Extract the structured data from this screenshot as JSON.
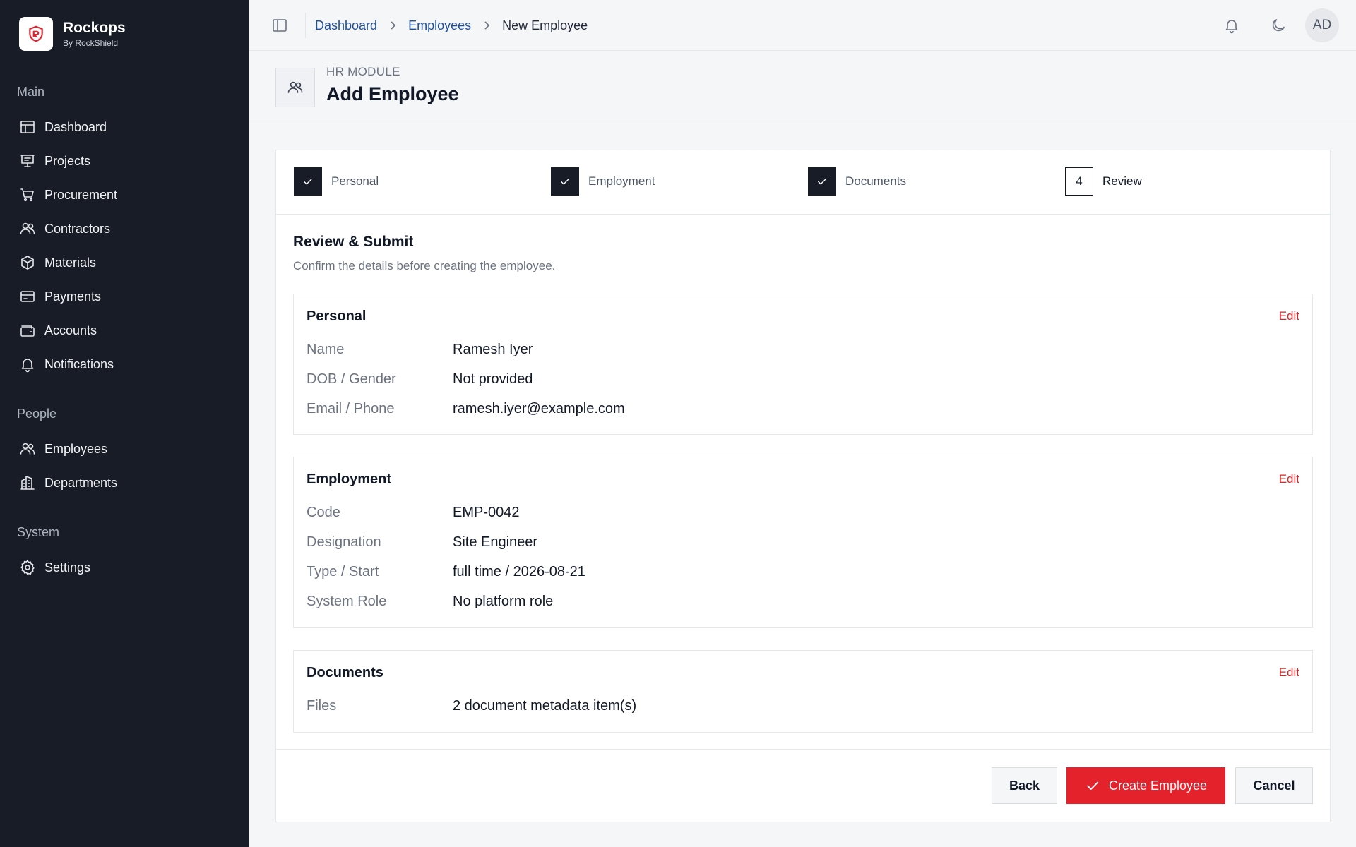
{
  "brand": {
    "name": "Rockops",
    "sub": "By RockShield",
    "accent": "#e3222c"
  },
  "sidebar": {
    "sections": [
      {
        "label": "Main",
        "items": [
          {
            "label": "Dashboard",
            "icon": "layout-icon"
          },
          {
            "label": "Projects",
            "icon": "presentation-icon"
          },
          {
            "label": "Procurement",
            "icon": "cart-icon"
          },
          {
            "label": "Contractors",
            "icon": "users-icon"
          },
          {
            "label": "Materials",
            "icon": "box-icon"
          },
          {
            "label": "Payments",
            "icon": "card-icon"
          },
          {
            "label": "Accounts",
            "icon": "wallet-icon"
          },
          {
            "label": "Notifications",
            "icon": "bell-icon"
          }
        ]
      },
      {
        "label": "People",
        "items": [
          {
            "label": "Employees",
            "icon": "users-icon"
          },
          {
            "label": "Departments",
            "icon": "building-icon"
          }
        ]
      },
      {
        "label": "System",
        "items": [
          {
            "label": "Settings",
            "icon": "gear-icon"
          }
        ]
      }
    ]
  },
  "topbar": {
    "breadcrumbs": [
      "Dashboard",
      "Employees",
      "New Employee"
    ],
    "avatar": "AD"
  },
  "header": {
    "kicker": "HR MODULE",
    "title": "Add Employee"
  },
  "steps": [
    {
      "label": "Personal",
      "status": "done"
    },
    {
      "label": "Employment",
      "status": "done"
    },
    {
      "label": "Documents",
      "status": "done"
    },
    {
      "label": "Review",
      "status": "current",
      "number": "4"
    }
  ],
  "review": {
    "title": "Review & Submit",
    "description": "Confirm the details before creating the employee.",
    "edit_label": "Edit",
    "blocks": [
      {
        "title": "Personal",
        "rows": [
          {
            "label": "Name",
            "value": "Ramesh Iyer"
          },
          {
            "label": "DOB / Gender",
            "value": "Not provided"
          },
          {
            "label": "Email / Phone",
            "value": "ramesh.iyer@example.com"
          }
        ]
      },
      {
        "title": "Employment",
        "rows": [
          {
            "label": "Code",
            "value": "EMP-0042"
          },
          {
            "label": "Designation",
            "value": "Site Engineer"
          },
          {
            "label": "Type / Start",
            "value": "full time / 2026-08-21"
          },
          {
            "label": "System Role",
            "value": "No platform role"
          }
        ]
      },
      {
        "title": "Documents",
        "rows": [
          {
            "label": "Files",
            "value": "2 document metadata item(s)"
          }
        ]
      }
    ]
  },
  "actions": {
    "back": "Back",
    "create": "Create Employee",
    "cancel": "Cancel"
  }
}
